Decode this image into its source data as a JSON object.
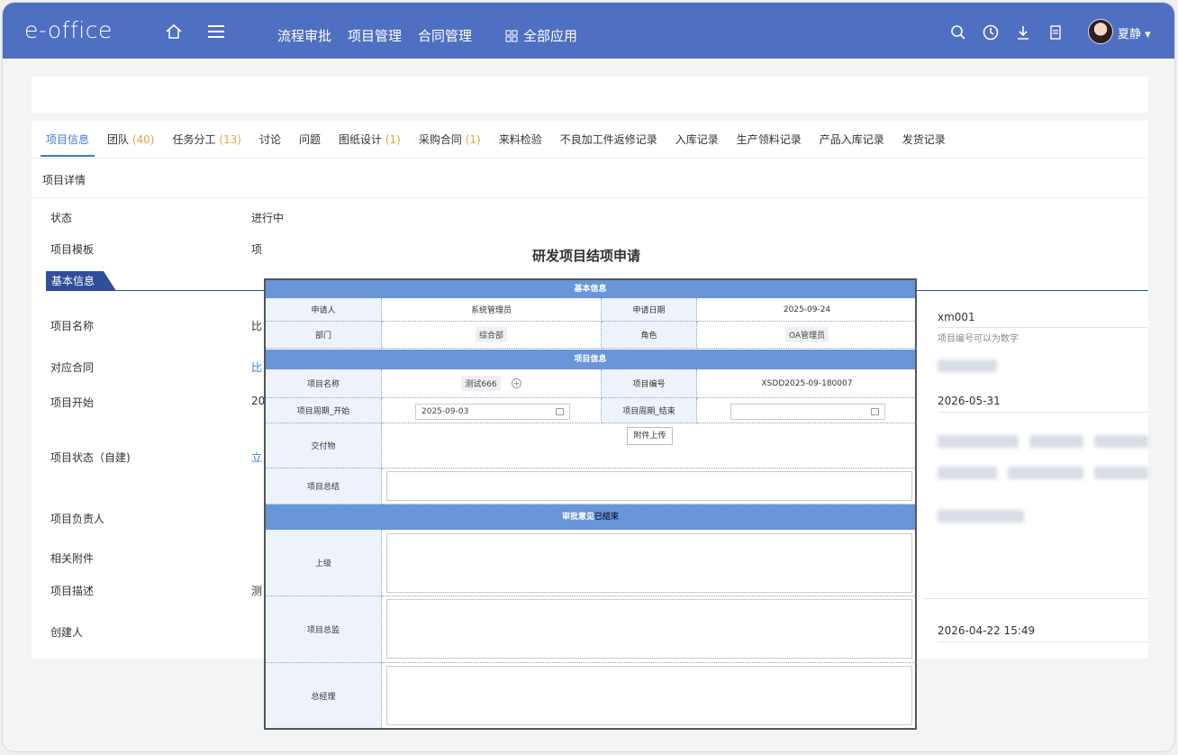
{
  "app": {
    "logo": "e-office"
  },
  "topnav": {
    "items": [
      "流程审批",
      "项目管理",
      "合同管理"
    ],
    "all_apps": "全部应用",
    "user": "夏静"
  },
  "tabs": [
    {
      "label": "项目信息",
      "count": ""
    },
    {
      "label": "团队",
      "count": "(40)"
    },
    {
      "label": "任务分工",
      "count": "(13)"
    },
    {
      "label": "讨论",
      "count": ""
    },
    {
      "label": "问题",
      "count": ""
    },
    {
      "label": "图纸设计",
      "count": "(1)"
    },
    {
      "label": "采购合同",
      "count": "(1)"
    },
    {
      "label": "来料检验",
      "count": ""
    },
    {
      "label": "不良加工件返修记录",
      "count": ""
    },
    {
      "label": "入库记录",
      "count": ""
    },
    {
      "label": "生产领料记录",
      "count": ""
    },
    {
      "label": "产品入库记录",
      "count": ""
    },
    {
      "label": "发货记录",
      "count": ""
    }
  ],
  "detail": {
    "section_title": "项目详情",
    "status_label": "状态",
    "status_value": "进行中",
    "template_label": "项目模板",
    "template_value": "项",
    "basic_badge": "基本信息",
    "rows": {
      "name_label": "项目名称",
      "name_value": "比",
      "contract_label": "对应合同",
      "contract_value": "比",
      "start_label": "项目开始",
      "start_value": "20",
      "state_label": "项目状态（自建)",
      "state_value": "立",
      "owner_label": "项目负责人",
      "attach_label": "相关附件",
      "desc_label": "项目描述",
      "desc_value": "测",
      "creator_label": "创建人"
    },
    "right": {
      "code": "xm001",
      "code_hint": "项目编号可以为数字",
      "end_date": "2026-05-31",
      "created_at": "2026-04-22 15:49"
    }
  },
  "form": {
    "title": "研发项目结项申请",
    "sec_basic": "基本信息",
    "applicant_label": "申请人",
    "applicant_value": "系统管理员",
    "date_label": "申请日期",
    "date_value": "2025-09-24",
    "dept_label": "部门",
    "dept_value": "综合部",
    "role_label": "角色",
    "role_value": "OA管理员",
    "sec_project": "项目信息",
    "pname_label": "项目名称",
    "pname_value": "测试666",
    "pcode_label": "项目编号",
    "pcode_value": "XSDD2025-09-180007",
    "pstart_label": "项目周期_开始",
    "pstart_value": "2025-09-03",
    "pend_label": "项目周期_结束",
    "pend_value": "",
    "deliver_label": "交付物",
    "upload_label": "附件上传",
    "summary_label": "项目总结",
    "sec_approval_a": "审批意见",
    "sec_approval_b": "已结束",
    "sup_label": "上级",
    "director_label": "项目总监",
    "gm_label": "总经理"
  }
}
